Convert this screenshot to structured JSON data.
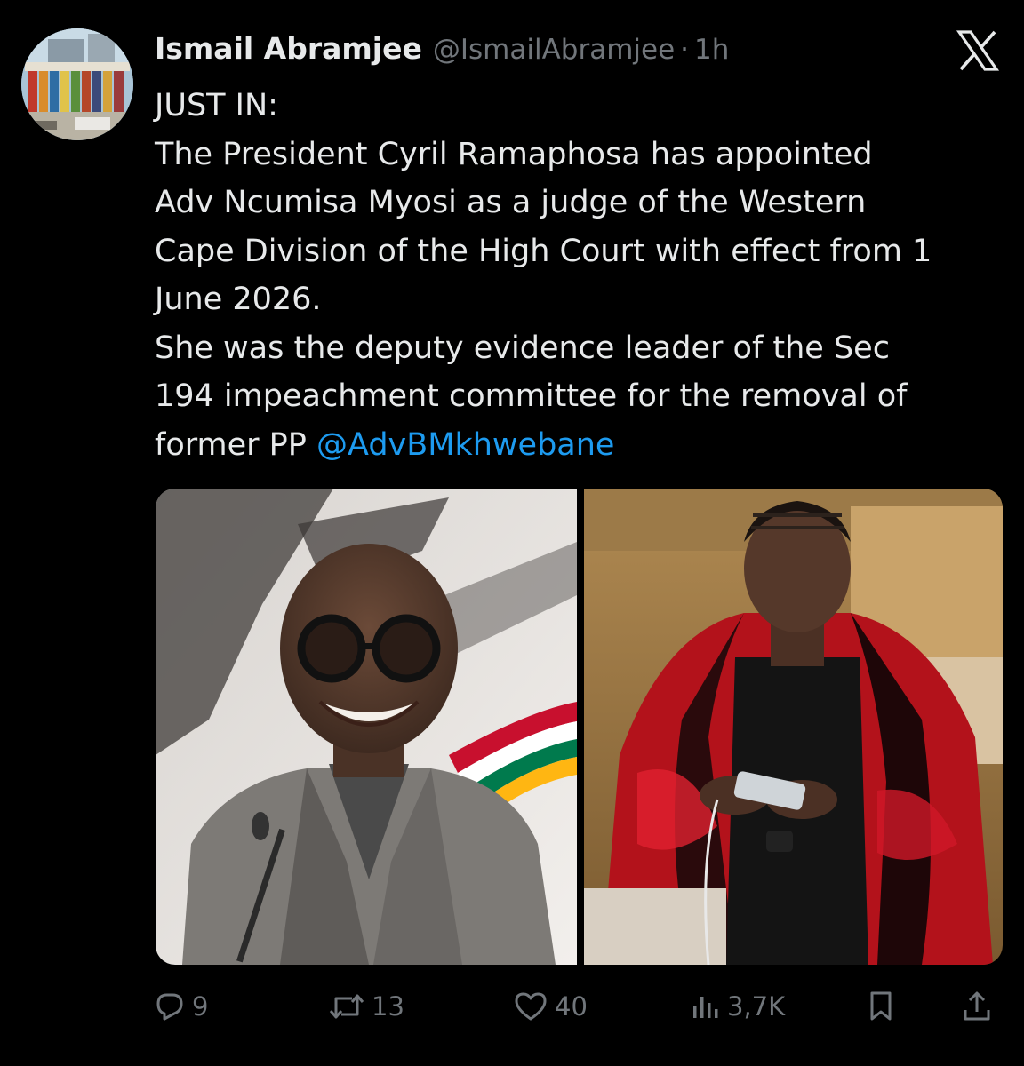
{
  "tweet": {
    "author": {
      "display_name": "Ismail Abramjee",
      "handle": "@IsmailAbramjee",
      "separator": "·",
      "time": "1h"
    },
    "text_lines": [
      "JUST IN:",
      "The President Cyril Ramaphosa has appointed",
      "Adv Ncumisa Myosi as a judge of the Western",
      "Cape Division of the High Court with effect from 1",
      "June 2026.",
      "She was the deputy evidence leader of the Sec",
      "194 impeachment committee for the removal of"
    ],
    "last_line_prefix": "former PP ",
    "mention": "@AdvBMkhwebane",
    "actions": {
      "reply_count": "9",
      "retweet_count": "13",
      "like_count": "40",
      "views_count": "3,7K"
    },
    "icons": {
      "platform": "x-logo-icon",
      "reply": "reply-icon",
      "retweet": "retweet-icon",
      "like": "heart-icon",
      "views": "views-icon",
      "bookmark": "bookmark-icon",
      "share": "share-icon"
    },
    "colors": {
      "background": "#000000",
      "text": "#e7e9ea",
      "secondary": "#71767b",
      "link": "#1d9bf0"
    }
  }
}
